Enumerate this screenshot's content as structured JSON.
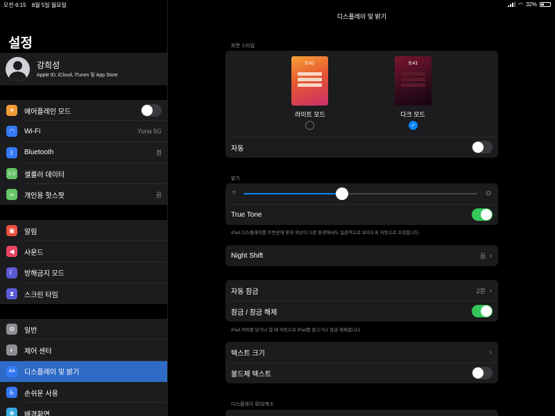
{
  "status": {
    "time": "오전 6:15",
    "date": "8월 5일 월요일",
    "battery": "32%",
    "battery_level": 0.32
  },
  "sidebar": {
    "title": "설정",
    "profile": {
      "name": "강희성",
      "subtitle": "Apple ID, iCloud, iTunes 및 App Store"
    },
    "group1": [
      {
        "label": "에어플레인 모드",
        "icon": "airplane-icon",
        "color": "#f09a37",
        "toggle": false
      },
      {
        "label": "Wi-Fi",
        "icon": "wifi-icon",
        "color": "#3478f6",
        "value": "Yuna 5G"
      },
      {
        "label": "Bluetooth",
        "icon": "bluetooth-icon",
        "color": "#3478f6",
        "value": "켬"
      },
      {
        "label": "셀룰러 데이터",
        "icon": "cellular-icon",
        "color": "#65c466"
      },
      {
        "label": "개인용 핫스팟",
        "icon": "hotspot-icon",
        "color": "#65c466",
        "value": "끔"
      }
    ],
    "group2": [
      {
        "label": "알림",
        "icon": "notifications-icon",
        "color": "#eb4d3d"
      },
      {
        "label": "사운드",
        "icon": "sound-icon",
        "color": "#eb4462"
      },
      {
        "label": "방해금지 모드",
        "icon": "moon-icon",
        "color": "#5b5ad6"
      },
      {
        "label": "스크린 타임",
        "icon": "hourglass-icon",
        "color": "#5b5ad6"
      }
    ],
    "group3": [
      {
        "label": "일반",
        "icon": "gear-icon",
        "color": "#8e8e93"
      },
      {
        "label": "제어 센터",
        "icon": "switches-icon",
        "color": "#8e8e93"
      },
      {
        "label": "디스플레이 및 밝기",
        "icon": "display-aa-icon",
        "color": "#3478f6",
        "active": true
      },
      {
        "label": "손쉬운 사용",
        "icon": "accessibility-icon",
        "color": "#3478f6"
      },
      {
        "label": "배경화면",
        "icon": "wallpaper-icon",
        "color": "#35aadc"
      }
    ]
  },
  "main": {
    "title": "디스플레이 및 밝기",
    "appearance_section": "화면 스타일",
    "light": {
      "label": "라이트 모드",
      "time": "9:41",
      "selected": false
    },
    "dark": {
      "label": "다크 모드",
      "time": "9:41",
      "selected": true
    },
    "auto_label": "자동",
    "auto_on": false,
    "brightness_section": "밝기",
    "brightness_level": 0.42,
    "true_tone_label": "True Tone",
    "true_tone_on": true,
    "true_tone_note": "iPad 디스플레이를 주변광에 맞춰 색상이 다른 환경에서도 일관적으로 보이도록 자동으로 조정합니다.",
    "night_shift_label": "Night Shift",
    "night_shift_value": "끔",
    "auto_lock_label": "자동 잠금",
    "auto_lock_value": "2분",
    "lock_unlock_label": "잠금 / 잠금 해제",
    "lock_unlock_on": true,
    "lock_note": "iPad 커버를 닫거나 열 때 자동으로 iPad를 잠그거나 잠금 해제합니다.",
    "text_size_label": "텍스트 크기",
    "bold_text_label": "볼드체 텍스트",
    "bold_text_on": false,
    "zoom_section": "디스플레이 확대/축소"
  }
}
